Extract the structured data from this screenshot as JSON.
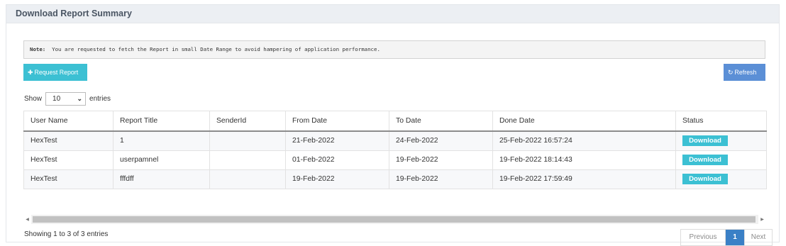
{
  "panel": {
    "title": "Download Report Summary"
  },
  "note": {
    "label": "Note:",
    "text": "You are requested to fetch the Report in small Date Range to avoid hampering of application performance."
  },
  "buttons": {
    "request": "Request Report",
    "refresh": "Refresh"
  },
  "length": {
    "show": "Show",
    "value": "10",
    "entries": "entries"
  },
  "table": {
    "columns": [
      "User Name",
      "Report Title",
      "SenderId",
      "From Date",
      "To Date",
      "Done Date",
      "Status"
    ],
    "rows": [
      {
        "user": "HexTest",
        "title": "1",
        "sender": "",
        "from": "21-Feb-2022",
        "to": "24-Feb-2022",
        "done": "25-Feb-2022 16:57:24",
        "status": "Download"
      },
      {
        "user": "HexTest",
        "title": "userpamnel",
        "sender": "",
        "from": "01-Feb-2022",
        "to": "19-Feb-2022",
        "done": "19-Feb-2022 18:14:43",
        "status": "Download"
      },
      {
        "user": "HexTest",
        "title": "fffdff",
        "sender": "",
        "from": "19-Feb-2022",
        "to": "19-Feb-2022",
        "done": "19-Feb-2022 17:59:49",
        "status": "Download"
      }
    ]
  },
  "info": "Showing 1 to 3 of 3 entries",
  "pagination": {
    "previous": "Previous",
    "current": "1",
    "next": "Next"
  },
  "colors": {
    "accent": "#3cc0d3",
    "refresh": "#5b8fd6",
    "page_active": "#3a80c6"
  }
}
